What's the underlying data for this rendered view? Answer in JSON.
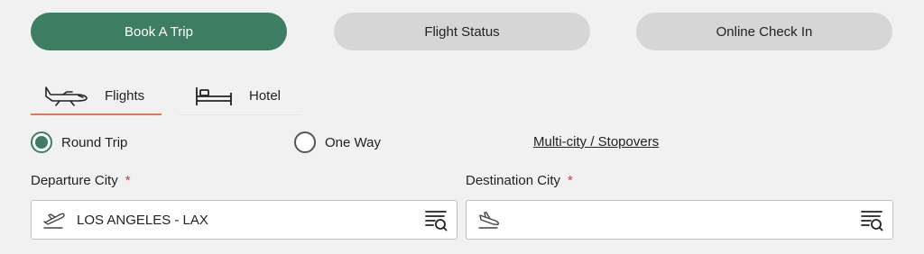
{
  "top_tabs": [
    {
      "label": "Book A Trip",
      "active": true
    },
    {
      "label": "Flight Status",
      "active": false
    },
    {
      "label": "Online Check In",
      "active": false
    }
  ],
  "product_tabs": [
    {
      "label": "Flights",
      "icon": "airplane-icon",
      "active": true
    },
    {
      "label": "Hotel",
      "icon": "bed-icon",
      "active": false
    }
  ],
  "trip_type": {
    "options": [
      {
        "label": "Round Trip",
        "selected": true
      },
      {
        "label": "One Way",
        "selected": false
      }
    ],
    "multicity_link": "Multi-city / Stopovers"
  },
  "departure": {
    "label": "Departure City",
    "required_marker": "*",
    "value": "LOS ANGELES - LAX",
    "placeholder": "",
    "icon": "takeoff-icon",
    "action_icon": "list-search-icon"
  },
  "destination": {
    "label": "Destination City",
    "required_marker": "*",
    "value": "",
    "placeholder": "",
    "icon": "landing-icon",
    "action_icon": "list-search-icon"
  },
  "colors": {
    "accent": "#3d7d62",
    "inactive_pill": "#d6d6d6",
    "tab_underline": "#e07a5f",
    "required": "#d9342b",
    "background": "#f1f1f1"
  }
}
